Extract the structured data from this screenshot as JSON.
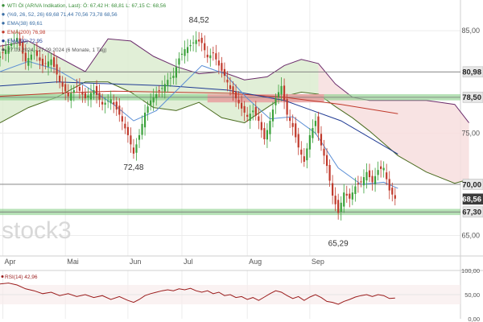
{
  "chart_data": {
    "type": "candlestick",
    "legend": [
      {
        "text": "WTI Öl (ARIVA Indikation, Last): Ö: 67,42  H: 68,81  L: 67,15  C: 68,56",
        "color": "#3a8f3a"
      },
      {
        "text": "(%9, 26, 52, 26)  69,68  71,44  70,56  73,78  68,56",
        "color": "#3a6ea5"
      },
      {
        "text": "EMA(38)  69,61",
        "color": "#3a6ea5"
      },
      {
        "text": "EMA(200)  76,98",
        "color": "#c0392b"
      },
      {
        "text": "EMA(90)  72,95",
        "color": "#1f3a93"
      },
      {
        "text": "27.03.2024 - 27.09.2024  (6 Monate, 1 Tag)",
        "color": "#555555"
      }
    ],
    "watermark": "stock3",
    "price_axis": {
      "ylim": [
        63,
        88
      ],
      "ticks": [
        "85,00",
        "75,00",
        "70,00",
        "65,00"
      ],
      "tick_values": [
        85,
        75,
        70,
        65
      ]
    },
    "x_labels": [
      {
        "label": "Apr",
        "t": 1
      },
      {
        "label": "Mai",
        "t": 23
      },
      {
        "label": "Jun",
        "t": 45
      },
      {
        "label": "Jul",
        "t": 64
      },
      {
        "label": "Aug",
        "t": 87
      },
      {
        "label": "Sep",
        "t": 109
      }
    ],
    "t_range": [
      0,
      162
    ],
    "horizontal_lines": [
      80.98,
      78.5,
      70.0,
      67.3
    ],
    "price_badges": [
      {
        "value": "80,98",
        "y": 80.98,
        "style": "grey"
      },
      {
        "value": "78,50",
        "y": 78.5,
        "style": "grey"
      },
      {
        "value": "70,00",
        "y": 70.0,
        "style": "grey"
      },
      {
        "value": "68,56",
        "y": 68.56,
        "style": "dark"
      },
      {
        "value": "67,30",
        "y": 67.3,
        "style": "grey"
      }
    ],
    "zones": [
      {
        "from": 78.2,
        "to": 78.8,
        "color": "#8fd18f"
      },
      {
        "from": 67.0,
        "to": 67.6,
        "color": "#8fd18f"
      }
    ],
    "red_zone": {
      "t_start": 73,
      "t_end": 114,
      "low": 78.0,
      "high": 78.8,
      "color": "#e9a3a3"
    },
    "annotations": [
      {
        "text": "84,52",
        "t": 70,
        "y": 85.8
      },
      {
        "text": "72,48",
        "t": 47,
        "y": 71.4
      },
      {
        "text": "65,29",
        "t": 119,
        "y": 64.0
      }
    ],
    "close": [
      [
        0,
        82.5
      ],
      [
        3,
        83.5
      ],
      [
        6,
        84.3
      ],
      [
        9,
        82.0
      ],
      [
        12,
        83.0
      ],
      [
        15,
        81.6
      ],
      [
        18,
        82.2
      ],
      [
        21,
        80.0
      ],
      [
        24,
        78.6
      ],
      [
        27,
        79.5
      ],
      [
        30,
        78.4
      ],
      [
        33,
        79.2
      ],
      [
        36,
        77.8
      ],
      [
        39,
        78.3
      ],
      [
        42,
        76.8
      ],
      [
        45,
        74.8
      ],
      [
        47,
        73.0
      ],
      [
        49,
        74.8
      ],
      [
        51,
        77.0
      ],
      [
        53,
        78.2
      ],
      [
        55,
        78.8
      ],
      [
        57,
        79.4
      ],
      [
        59,
        80.2
      ],
      [
        61,
        80.6
      ],
      [
        63,
        82.3
      ],
      [
        65,
        83.2
      ],
      [
        67,
        83.6
      ],
      [
        69,
        84.1
      ],
      [
        71,
        83.8
      ],
      [
        73,
        82.4
      ],
      [
        75,
        82.8
      ],
      [
        77,
        81.6
      ],
      [
        79,
        80.6
      ],
      [
        81,
        79.3
      ],
      [
        83,
        78.4
      ],
      [
        85,
        77.4
      ],
      [
        87,
        76.6
      ],
      [
        89,
        77.2
      ],
      [
        91,
        76.2
      ],
      [
        93,
        74.4
      ],
      [
        95,
        76.2
      ],
      [
        97,
        78.4
      ],
      [
        99,
        79.6
      ],
      [
        101,
        76.8
      ],
      [
        103,
        75.6
      ],
      [
        105,
        73.6
      ],
      [
        107,
        72.2
      ],
      [
        109,
        74.8
      ],
      [
        111,
        76.2
      ],
      [
        113,
        73.8
      ],
      [
        115,
        71.8
      ],
      [
        117,
        68.9
      ],
      [
        119,
        67.2
      ],
      [
        121,
        69.2
      ],
      [
        123,
        68.6
      ],
      [
        125,
        69.8
      ],
      [
        127,
        70.2
      ],
      [
        129,
        71.2
      ],
      [
        131,
        70.2
      ],
      [
        133,
        71.4
      ],
      [
        135,
        71.6
      ],
      [
        137,
        69.4
      ],
      [
        139,
        68.6
      ]
    ],
    "cloud_upper": [
      [
        0,
        83.5
      ],
      [
        10,
        84.0
      ],
      [
        20,
        82.5
      ],
      [
        30,
        81.0
      ],
      [
        38,
        84.2
      ],
      [
        46,
        84.0
      ],
      [
        54,
        82.5
      ],
      [
        62,
        81.5
      ],
      [
        70,
        80.8
      ],
      [
        78,
        81.0
      ],
      [
        86,
        80.2
      ],
      [
        94,
        80.5
      ],
      [
        100,
        81.6
      ],
      [
        106,
        82.2
      ],
      [
        112,
        81.8
      ],
      [
        118,
        79.8
      ],
      [
        124,
        78.5
      ],
      [
        130,
        78.2
      ],
      [
        140,
        78.2
      ],
      [
        150,
        78.2
      ],
      [
        160,
        77.8
      ],
      [
        165,
        76.0
      ]
    ],
    "cloud_lower": [
      [
        0,
        76.0
      ],
      [
        10,
        77.5
      ],
      [
        20,
        78.5
      ],
      [
        30,
        80.0
      ],
      [
        38,
        80.0
      ],
      [
        46,
        79.0
      ],
      [
        54,
        77.5
      ],
      [
        62,
        77.2
      ],
      [
        70,
        78.0
      ],
      [
        78,
        76.5
      ],
      [
        86,
        76.0
      ],
      [
        94,
        77.5
      ],
      [
        100,
        78.6
      ],
      [
        106,
        79.0
      ],
      [
        112,
        78.8
      ],
      [
        118,
        77.6
      ],
      [
        124,
        76.5
      ],
      [
        130,
        75.2
      ],
      [
        140,
        72.8
      ],
      [
        150,
        71.2
      ],
      [
        160,
        70.1
      ],
      [
        165,
        70.5
      ]
    ],
    "ema_200": [
      [
        0,
        78.6
      ],
      [
        20,
        78.9
      ],
      [
        40,
        79.1
      ],
      [
        60,
        79.0
      ],
      [
        80,
        78.9
      ],
      [
        100,
        78.5
      ],
      [
        120,
        77.8
      ],
      [
        140,
        76.9
      ]
    ],
    "ema_90": [
      [
        0,
        79.6
      ],
      [
        20,
        80.0
      ],
      [
        40,
        79.8
      ],
      [
        60,
        79.6
      ],
      [
        80,
        79.2
      ],
      [
        100,
        78.2
      ],
      [
        120,
        76.2
      ],
      [
        140,
        72.95
      ]
    ],
    "ema_38": [
      [
        0,
        81.0
      ],
      [
        10,
        82.0
      ],
      [
        20,
        81.2
      ],
      [
        30,
        79.6
      ],
      [
        40,
        77.8
      ],
      [
        47,
        76.2
      ],
      [
        55,
        77.2
      ],
      [
        63,
        79.4
      ],
      [
        71,
        81.6
      ],
      [
        79,
        80.8
      ],
      [
        87,
        78.4
      ],
      [
        95,
        76.4
      ],
      [
        103,
        76.6
      ],
      [
        111,
        75.0
      ],
      [
        119,
        71.6
      ],
      [
        127,
        70.0
      ],
      [
        135,
        70.2
      ],
      [
        140,
        69.61
      ]
    ],
    "rsi": {
      "label": "RSI(14)  42,96",
      "ticks": [
        "100,00",
        "50,00",
        "0,00"
      ],
      "tick_values": [
        100,
        50,
        0
      ],
      "values": [
        [
          0,
          72
        ],
        [
          3,
          74
        ],
        [
          6,
          70
        ],
        [
          9,
          62
        ],
        [
          12,
          58
        ],
        [
          15,
          52
        ],
        [
          18,
          55
        ],
        [
          21,
          48
        ],
        [
          24,
          52
        ],
        [
          27,
          46
        ],
        [
          30,
          50
        ],
        [
          33,
          44
        ],
        [
          36,
          48
        ],
        [
          39,
          40
        ],
        [
          42,
          46
        ],
        [
          45,
          38
        ],
        [
          47,
          34
        ],
        [
          49,
          40
        ],
        [
          51,
          48
        ],
        [
          53,
          52
        ],
        [
          55,
          55
        ],
        [
          57,
          58
        ],
        [
          59,
          60
        ],
        [
          61,
          58
        ],
        [
          63,
          62
        ],
        [
          65,
          60
        ],
        [
          67,
          63
        ],
        [
          69,
          58
        ],
        [
          71,
          55
        ],
        [
          73,
          58
        ],
        [
          75,
          52
        ],
        [
          77,
          55
        ],
        [
          79,
          48
        ],
        [
          81,
          50
        ],
        [
          83,
          44
        ],
        [
          85,
          46
        ],
        [
          87,
          40
        ],
        [
          89,
          44
        ],
        [
          91,
          38
        ],
        [
          93,
          45
        ],
        [
          95,
          52
        ],
        [
          97,
          58
        ],
        [
          99,
          55
        ],
        [
          101,
          48
        ],
        [
          103,
          42
        ],
        [
          105,
          46
        ],
        [
          107,
          38
        ],
        [
          109,
          45
        ],
        [
          111,
          50
        ],
        [
          113,
          44
        ],
        [
          115,
          36
        ],
        [
          117,
          34
        ],
        [
          119,
          30
        ],
        [
          121,
          36
        ],
        [
          123,
          40
        ],
        [
          125,
          45
        ],
        [
          127,
          48
        ],
        [
          129,
          50
        ],
        [
          131,
          46
        ],
        [
          133,
          50
        ],
        [
          135,
          48
        ],
        [
          137,
          42
        ],
        [
          139,
          42.96
        ]
      ]
    }
  }
}
